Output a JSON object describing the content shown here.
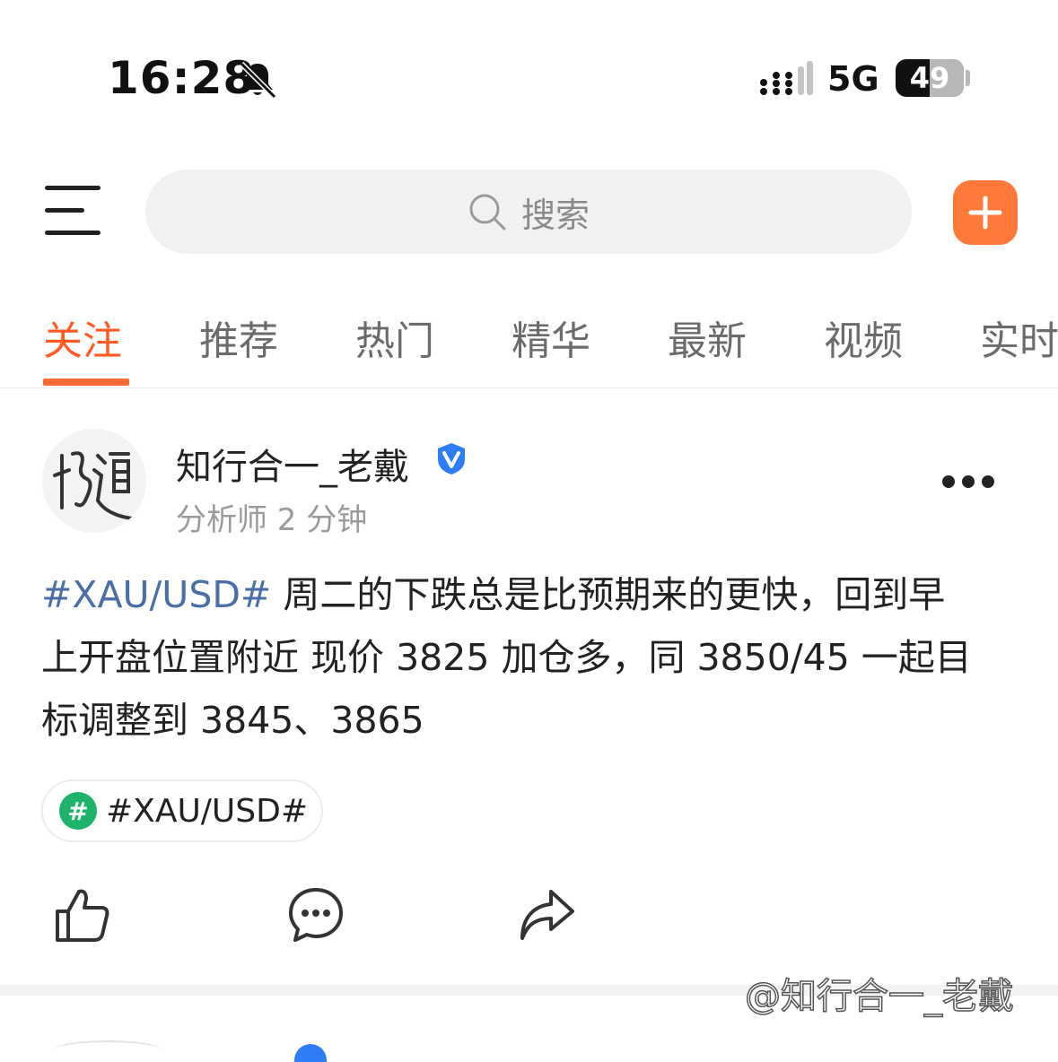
{
  "status_bar": {
    "time": "16:28",
    "network": "5G",
    "battery": "49",
    "battery_level": 0.49
  },
  "search": {
    "placeholder": "搜索"
  },
  "tabs": [
    "关注",
    "推荐",
    "热门",
    "精华",
    "最新",
    "视频",
    "实时"
  ],
  "active_tab": "关注",
  "post": {
    "author": "知行合一_老戴",
    "avatar_text": "悟道",
    "meta": "分析师 2 分钟",
    "hashtag": "#XAU/USD#",
    "body_line1": " 周二的下跌总是比预期来的更快，回到早",
    "body_line2": "上开盘位置附近 现价 3825 加仓多，同 3850/45 一起目",
    "body_line3": "标调整到 3845、3865",
    "topic_chip": "#XAU/USD#",
    "topic_icon_text": "#"
  },
  "watermark": "@知行合一_老戴",
  "colors": {
    "accent": "#ff5a24",
    "add_button": "#ff7a3a",
    "hashtag": "#4a6ea8",
    "topic_icon": "#1db36a",
    "verified": "#2e7cf6"
  },
  "icons": [
    "bell-slash-icon",
    "signal-icon",
    "battery-icon",
    "menu-icon",
    "search-icon",
    "plus-icon",
    "verified-icon",
    "more-icon",
    "like-icon",
    "comment-icon",
    "share-icon"
  ]
}
